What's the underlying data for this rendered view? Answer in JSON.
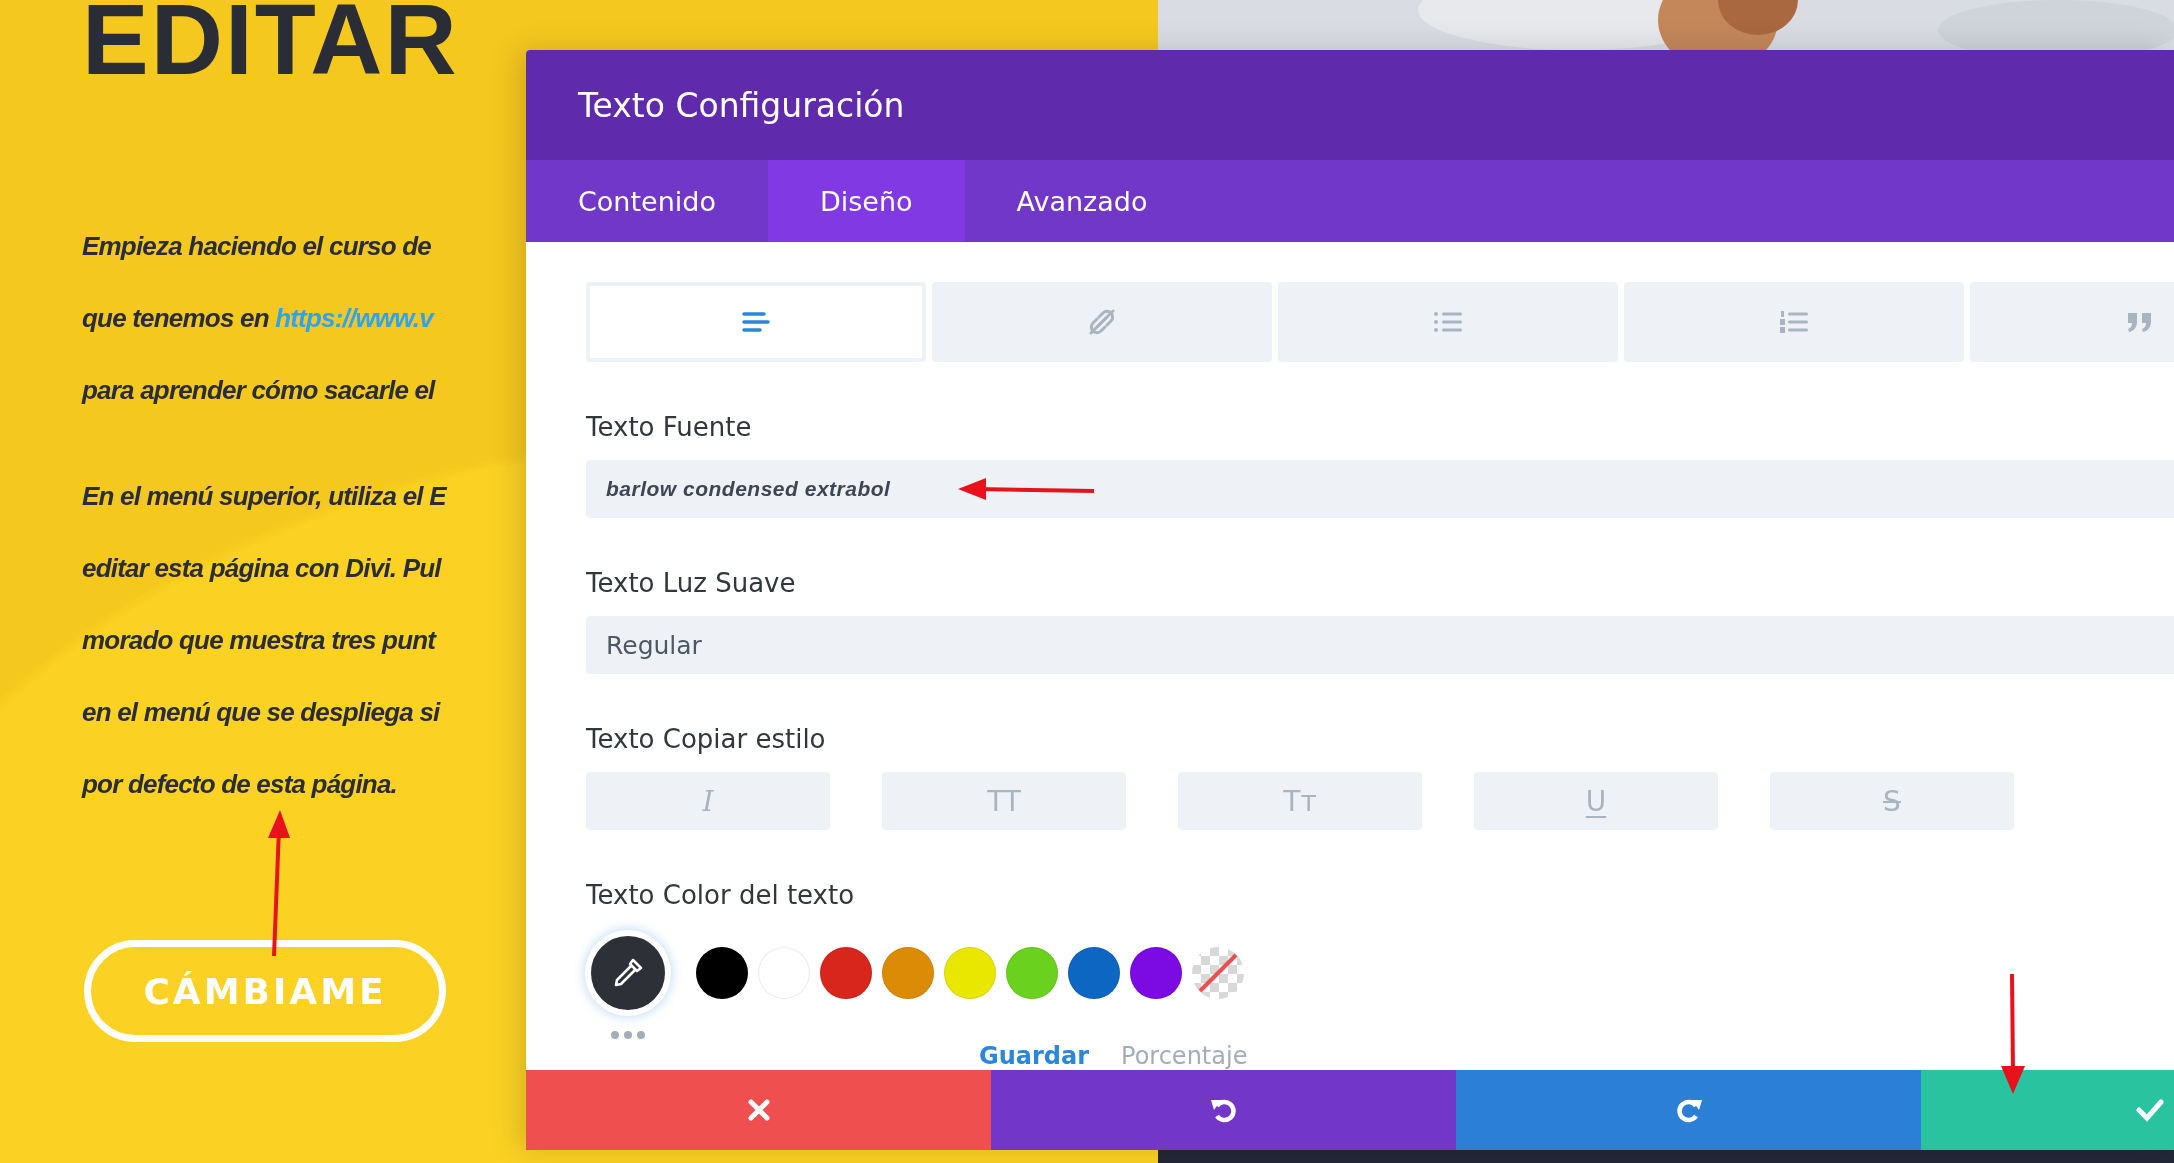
{
  "page": {
    "heading": "EDITAR",
    "paragraphs": [
      {
        "lines": [
          {
            "text": "Empieza haciendo el curso de"
          },
          {
            "text": "que tenemos en ",
            "link": "https://www.v"
          },
          {
            "text": "para aprender cómo sacarle el"
          }
        ]
      },
      {
        "lines": [
          {
            "text": "En el menú superior, utiliza el E"
          },
          {
            "text": "editar esta página con Divi. Pul"
          },
          {
            "text": "morado que muestra tres punt"
          },
          {
            "text": "en el menú que se despliega si"
          },
          {
            "text": "por defecto de esta página."
          }
        ]
      }
    ],
    "button": "CÁMBIAME"
  },
  "modal": {
    "title": "Texto Configuración",
    "tabs": [
      {
        "label": "Contenido",
        "selected": false
      },
      {
        "label": "Diseño",
        "selected": true
      },
      {
        "label": "Avanzado",
        "selected": false
      }
    ],
    "icon_tabs": [
      {
        "kind": "align",
        "selected": true
      },
      {
        "kind": "link",
        "selected": false
      },
      {
        "kind": "bullets",
        "selected": false
      },
      {
        "kind": "numbers",
        "selected": false
      },
      {
        "kind": "quote",
        "selected": false
      }
    ],
    "font_field": {
      "label": "Texto Fuente",
      "value": "barlow condensed extrabol"
    },
    "weight_field": {
      "label": "Texto Luz Suave",
      "value": "Regular"
    },
    "style_label": "Texto Copiar estilo",
    "style_buttons": [
      {
        "kind": "italic",
        "glyph": "I"
      },
      {
        "kind": "upper",
        "glyph": "TT"
      },
      {
        "kind": "smallcaps",
        "glyph": "Tᴛ"
      },
      {
        "kind": "underline",
        "glyph": "U"
      },
      {
        "kind": "strike",
        "glyph": "S"
      }
    ],
    "color_label": "Texto Color del texto",
    "swatches": [
      {
        "kind": "color",
        "color": "#000000"
      },
      {
        "kind": "color",
        "color": "#ffffff"
      },
      {
        "kind": "color",
        "color": "#d9261c"
      },
      {
        "kind": "color",
        "color": "#dc8b06"
      },
      {
        "kind": "color",
        "color": "#e9e700"
      },
      {
        "kind": "color",
        "color": "#6ad21e"
      },
      {
        "kind": "color",
        "color": "#0d67c2"
      },
      {
        "kind": "color",
        "color": "#7c0ae2"
      },
      {
        "kind": "transparent"
      }
    ],
    "palette_links": [
      {
        "label": "Guardar",
        "selected": true
      },
      {
        "label": "Porcentaje",
        "selected": false
      }
    ],
    "actions": [
      {
        "kind": "cancel"
      },
      {
        "kind": "undo"
      },
      {
        "kind": "redo"
      },
      {
        "kind": "save"
      }
    ]
  }
}
